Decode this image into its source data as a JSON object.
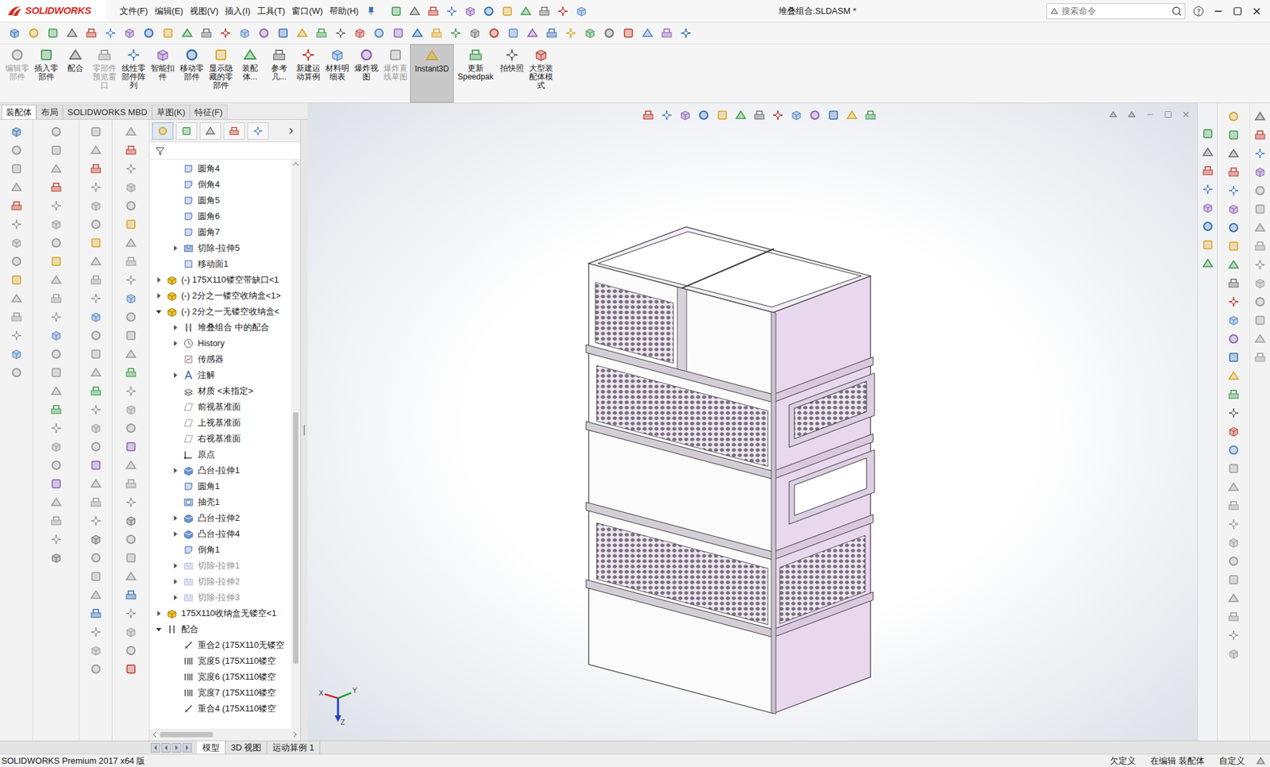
{
  "app": {
    "logo": "SOLIDWORKS",
    "title": "堆叠组合.SLDASM *"
  },
  "menu": [
    "文件(F)",
    "编辑(E)",
    "视图(V)",
    "插入(I)",
    "工具(T)",
    "窗口(W)",
    "帮助(H)"
  ],
  "search": {
    "placeholder": "搜索命令"
  },
  "ribbon": [
    {
      "label": "编辑零部件",
      "disabled": true,
      "selected": false
    },
    {
      "label": "插入零部件",
      "disabled": false,
      "selected": false
    },
    {
      "label": "配合",
      "disabled": false,
      "selected": false
    },
    {
      "label": "零部件预览窗口",
      "disabled": true,
      "selected": false
    },
    {
      "label": "线性零部件阵列",
      "disabled": false,
      "selected": false
    },
    {
      "label": "智能扣件",
      "disabled": false,
      "selected": false
    },
    {
      "label": "移动零部件",
      "disabled": false,
      "selected": false
    },
    {
      "label": "显示隐藏的零部件",
      "disabled": false,
      "selected": false
    },
    {
      "label": "装配体...",
      "disabled": false,
      "selected": false
    },
    {
      "label": "参考几...",
      "disabled": false,
      "selected": false
    },
    {
      "label": "新建运动算例",
      "disabled": false,
      "selected": false
    },
    {
      "label": "材料明细表",
      "disabled": false,
      "selected": false
    },
    {
      "label": "爆炸视图",
      "disabled": false,
      "selected": false
    },
    {
      "label": "爆炸直线草图",
      "disabled": true,
      "selected": false
    },
    {
      "label": "Instant3D",
      "disabled": false,
      "selected": true
    },
    {
      "label": "更新Speedpak",
      "disabled": false,
      "selected": false
    },
    {
      "label": "拍快照",
      "disabled": false,
      "selected": false
    },
    {
      "label": "大型装配体模式",
      "disabled": false,
      "selected": false
    }
  ],
  "tabs": [
    {
      "label": "装配体",
      "selected": true
    },
    {
      "label": "布局",
      "selected": false
    },
    {
      "label": "SOLIDWORKS MBD",
      "selected": false
    },
    {
      "label": "草图(K)",
      "selected": false
    },
    {
      "label": "特征(F)",
      "selected": false
    }
  ],
  "tree": [
    {
      "label": "圆角4",
      "depth": 2,
      "expander": "none",
      "kind": "fillet",
      "suppressed": false
    },
    {
      "label": "倒角4",
      "depth": 2,
      "expander": "none",
      "kind": "chamfer",
      "suppressed": false
    },
    {
      "label": "圆角5",
      "depth": 2,
      "expander": "none",
      "kind": "fillet",
      "suppressed": false
    },
    {
      "label": "圆角6",
      "depth": 2,
      "expander": "none",
      "kind": "fillet",
      "suppressed": false
    },
    {
      "label": "圆角7",
      "depth": 2,
      "expander": "none",
      "kind": "fillet",
      "suppressed": false
    },
    {
      "label": "切除-拉伸5",
      "depth": 2,
      "expander": "collapsed",
      "kind": "cut",
      "suppressed": false
    },
    {
      "label": "移动面1",
      "depth": 2,
      "expander": "none",
      "kind": "move",
      "suppressed": false
    },
    {
      "label": "(-) 175X110镂空带缺口<1",
      "depth": 1,
      "expander": "collapsed",
      "kind": "part",
      "suppressed": false
    },
    {
      "label": "(-) 2分之一镂空收纳盒<1>",
      "depth": 1,
      "expander": "collapsed",
      "kind": "part",
      "suppressed": false
    },
    {
      "label": "(-) 2分之一无镂空收纳盒<",
      "depth": 1,
      "expander": "expanded",
      "kind": "part",
      "suppressed": false
    },
    {
      "label": "堆叠组合 中的配合",
      "depth": 2,
      "expander": "collapsed",
      "kind": "mates",
      "suppressed": false
    },
    {
      "label": "History",
      "depth": 2,
      "expander": "collapsed",
      "kind": "history",
      "suppressed": false
    },
    {
      "label": "传感器",
      "depth": 2,
      "expander": "none",
      "kind": "sensor",
      "suppressed": false
    },
    {
      "label": "注解",
      "depth": 2,
      "expander": "collapsed",
      "kind": "annotation",
      "suppressed": false
    },
    {
      "label": "材质 <未指定>",
      "depth": 2,
      "expander": "none",
      "kind": "material",
      "suppressed": false
    },
    {
      "label": "前视基准面",
      "depth": 2,
      "expander": "none",
      "kind": "plane",
      "suppressed": false
    },
    {
      "label": "上视基准面",
      "depth": 2,
      "expander": "none",
      "kind": "plane",
      "suppressed": false
    },
    {
      "label": "右视基准面",
      "depth": 2,
      "expander": "none",
      "kind": "plane",
      "suppressed": false
    },
    {
      "label": "原点",
      "depth": 2,
      "expander": "none",
      "kind": "origin",
      "suppressed": false
    },
    {
      "label": "凸台-拉伸1",
      "depth": 2,
      "expander": "collapsed",
      "kind": "boss",
      "suppressed": false
    },
    {
      "label": "圆角1",
      "depth": 2,
      "expander": "none",
      "kind": "fillet",
      "suppressed": false
    },
    {
      "label": "抽壳1",
      "depth": 2,
      "expander": "none",
      "kind": "shell",
      "suppressed": false
    },
    {
      "label": "凸台-拉伸2",
      "depth": 2,
      "expander": "collapsed",
      "kind": "boss",
      "suppressed": false
    },
    {
      "label": "凸台-拉伸4",
      "depth": 2,
      "expander": "collapsed",
      "kind": "boss",
      "suppressed": false
    },
    {
      "label": "倒角1",
      "depth": 2,
      "expander": "none",
      "kind": "chamfer",
      "suppressed": false
    },
    {
      "label": "切除-拉伸1",
      "depth": 2,
      "expander": "collapsed",
      "kind": "cut",
      "suppressed": true
    },
    {
      "label": "切除-拉伸2",
      "depth": 2,
      "expander": "collapsed",
      "kind": "cut",
      "suppressed": true
    },
    {
      "label": "切除-拉伸3",
      "depth": 2,
      "expander": "collapsed",
      "kind": "cut",
      "suppressed": true
    },
    {
      "label": "175X110收纳盒无镂空<1",
      "depth": 1,
      "expander": "collapsed",
      "kind": "part",
      "suppressed": false
    },
    {
      "label": "配合",
      "depth": 1,
      "expander": "expanded",
      "kind": "mates",
      "suppressed": false
    },
    {
      "label": "重合2 (175X110无镂空",
      "depth": 2,
      "expander": "none",
      "kind": "coincident",
      "suppressed": false
    },
    {
      "label": "宽度5 (175X110镂空",
      "depth": 2,
      "expander": "none",
      "kind": "width",
      "suppressed": false
    },
    {
      "label": "宽度6 (175X110镂空",
      "depth": 2,
      "expander": "none",
      "kind": "width",
      "suppressed": false
    },
    {
      "label": "宽度7 (175X110镂空",
      "depth": 2,
      "expander": "none",
      "kind": "width",
      "suppressed": false
    },
    {
      "label": "重合4 (175X110镂空",
      "depth": 2,
      "expander": "none",
      "kind": "coincident",
      "suppressed": false
    }
  ],
  "model": {
    "tiers": [
      {
        "kind": "split"
      },
      {
        "kind": "perforated-handle"
      },
      {
        "kind": "plain-handle"
      },
      {
        "kind": "perforated"
      },
      {
        "kind": "plain"
      }
    ]
  },
  "triad": {
    "x": "X",
    "y": "Y",
    "z": "Z"
  },
  "bottomTabs": [
    {
      "label": "模型",
      "selected": true
    },
    {
      "label": "3D 视图",
      "selected": false
    },
    {
      "label": "运动算例 1",
      "selected": false
    }
  ],
  "status": {
    "product": "SOLIDWORKS Premium 2017 x64 版",
    "fields": [
      "欠定义",
      "在编辑 装配体",
      "自定义"
    ]
  }
}
